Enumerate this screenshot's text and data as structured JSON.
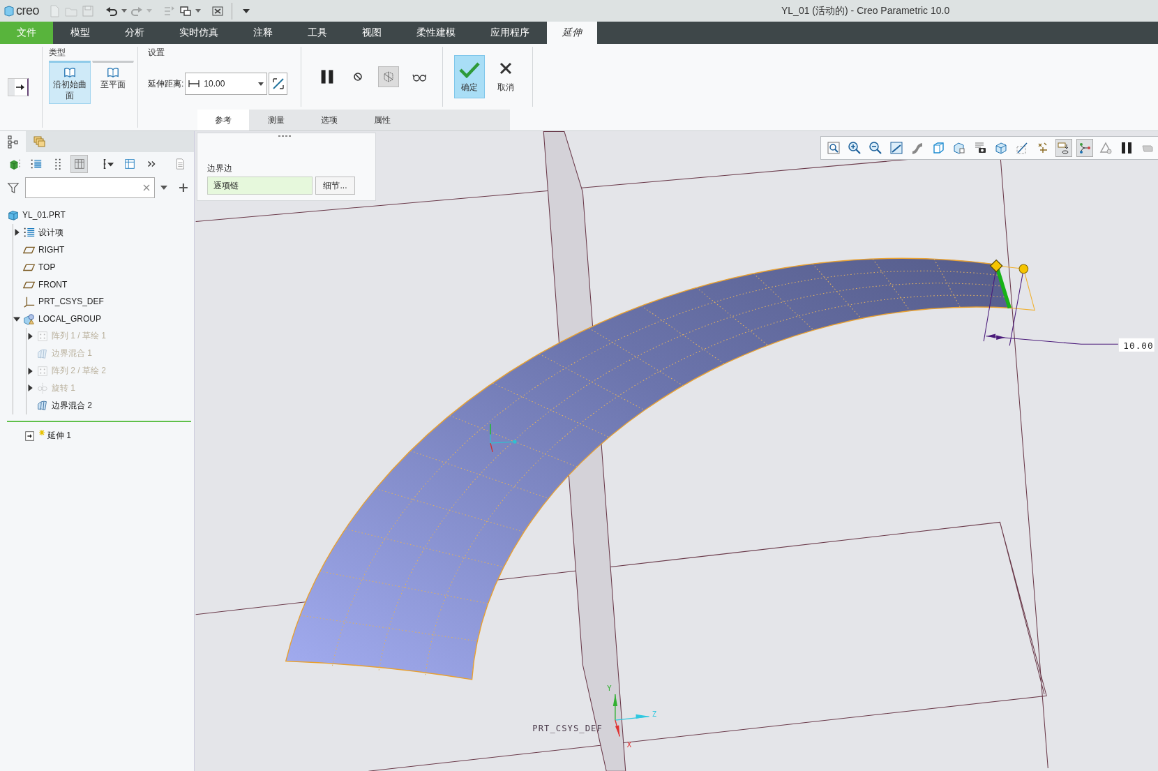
{
  "title_bar": {
    "app_name": "creo",
    "title": "YL_01 (活动的) - Creo Parametric 10.0",
    "quick_access": [
      {
        "kind": "new",
        "disabled": true
      },
      {
        "kind": "open",
        "disabled": true
      },
      {
        "kind": "save",
        "disabled": true
      },
      {
        "kind": "undo",
        "disabled": false
      },
      {
        "kind": "redo",
        "disabled": true
      },
      {
        "kind": "regenerate",
        "disabled": true
      },
      {
        "kind": "windows",
        "disabled": false
      },
      {
        "kind": "close",
        "disabled": false
      },
      {
        "kind": "customize",
        "disabled": false
      }
    ]
  },
  "menu_tabs": [
    {
      "label": "文件",
      "kind": "file",
      "selected": false
    },
    {
      "label": "模型",
      "kind": "tab",
      "selected": false
    },
    {
      "label": "分析",
      "kind": "tab",
      "selected": false
    },
    {
      "label": "实时仿真",
      "kind": "tab",
      "selected": false
    },
    {
      "label": "注释",
      "kind": "tab",
      "selected": false
    },
    {
      "label": "工具",
      "kind": "tab",
      "selected": false
    },
    {
      "label": "视图",
      "kind": "tab",
      "selected": false
    },
    {
      "label": "柔性建模",
      "kind": "tab",
      "selected": false
    },
    {
      "label": "应用程序",
      "kind": "tab",
      "selected": false
    },
    {
      "label": "延伸",
      "kind": "tab",
      "selected": true
    }
  ],
  "ribbon": {
    "type_group": {
      "label": "类型",
      "options": [
        {
          "label": "沿初始曲面",
          "selected": true
        },
        {
          "label": "至平面",
          "selected": false
        }
      ]
    },
    "settings_group": {
      "label": "设置",
      "distance_label": "延伸距离:",
      "distance_value": "10.00"
    },
    "tools": [
      {
        "kind": "pause",
        "on": false
      },
      {
        "kind": "stop",
        "on": false
      },
      {
        "kind": "preview",
        "on": true
      },
      {
        "kind": "glasses",
        "on": false
      }
    ],
    "ok": {
      "label": "确定",
      "selected": true
    },
    "cancel": {
      "label": "取消"
    },
    "panel_tabs": [
      {
        "label": "参考",
        "selected": true
      },
      {
        "label": "测量",
        "selected": false
      },
      {
        "label": "选项",
        "selected": false
      },
      {
        "label": "属性",
        "selected": false
      }
    ]
  },
  "references_panel": {
    "label": "边界边",
    "value": "逐项链",
    "details_button": "细节..."
  },
  "model_tree": {
    "tabs": [
      {
        "kind": "tree",
        "selected": true
      },
      {
        "kind": "layers",
        "selected": false
      }
    ],
    "toolbar": [
      {
        "kind": "settings",
        "on": false
      },
      {
        "kind": "list",
        "on": false
      },
      {
        "kind": "dots",
        "on": false
      },
      {
        "kind": "columns",
        "on": true
      },
      {
        "kind": "filter",
        "on": false
      },
      {
        "kind": "table",
        "on": false
      },
      {
        "kind": "more",
        "on": false
      },
      {
        "kind": "document",
        "on": false
      }
    ],
    "items": [
      {
        "label": "YL_01.PRT",
        "kind": "part",
        "dimmed": false,
        "children": [
          {
            "label": "设计项",
            "kind": "list",
            "expanded": false,
            "dimmed": false
          },
          {
            "label": "RIGHT",
            "kind": "plane",
            "dimmed": false
          },
          {
            "label": "TOP",
            "kind": "plane",
            "dimmed": false
          },
          {
            "label": "FRONT",
            "kind": "plane",
            "dimmed": false
          },
          {
            "label": "PRT_CSYS_DEF",
            "kind": "csys",
            "dimmed": false
          },
          {
            "label": "LOCAL_GROUP",
            "kind": "group",
            "expanded": true,
            "dimmed": false,
            "children": [
              {
                "label": "阵列 1 / 草绘 1",
                "kind": "pattern",
                "expanded": false,
                "dimmed": true
              },
              {
                "label": "边界混合 1",
                "kind": "blend",
                "dimmed": true
              },
              {
                "label": "阵列 2 / 草绘 2",
                "kind": "pattern",
                "expanded": false,
                "dimmed": true
              },
              {
                "label": "旋转 1",
                "kind": "revolve",
                "expanded": false,
                "dimmed": true
              },
              {
                "label": "边界混合 2",
                "kind": "blend",
                "dimmed": false
              }
            ]
          }
        ]
      }
    ],
    "after_insert": [
      {
        "label": "延伸 1",
        "kind": "extend",
        "new": true
      }
    ]
  },
  "graphics": {
    "dimension": "10.00",
    "csys_label": "PRT_CSYS_DEF",
    "axis_labels": {
      "x": "X",
      "y": "Y",
      "z": "Z"
    },
    "view_toolbar": [
      {
        "kind": "refit",
        "on": false
      },
      {
        "kind": "zoom-in",
        "on": false
      },
      {
        "kind": "zoom-out",
        "on": false
      },
      {
        "kind": "repaint",
        "on": false
      },
      {
        "kind": "display-style",
        "on": false
      },
      {
        "kind": "saved-views",
        "on": false
      },
      {
        "kind": "view-manager",
        "on": false
      },
      {
        "kind": "snapshot",
        "on": false
      },
      {
        "kind": "perspective",
        "on": false
      },
      {
        "kind": "section",
        "on": false
      },
      {
        "kind": "datum-display",
        "on": false
      },
      {
        "kind": "annotation-display",
        "on": true
      },
      {
        "kind": "spin-center",
        "on": true
      },
      {
        "kind": "triangle",
        "on": false
      },
      {
        "kind": "pause",
        "on": false
      },
      {
        "kind": "last",
        "on": false
      }
    ]
  }
}
